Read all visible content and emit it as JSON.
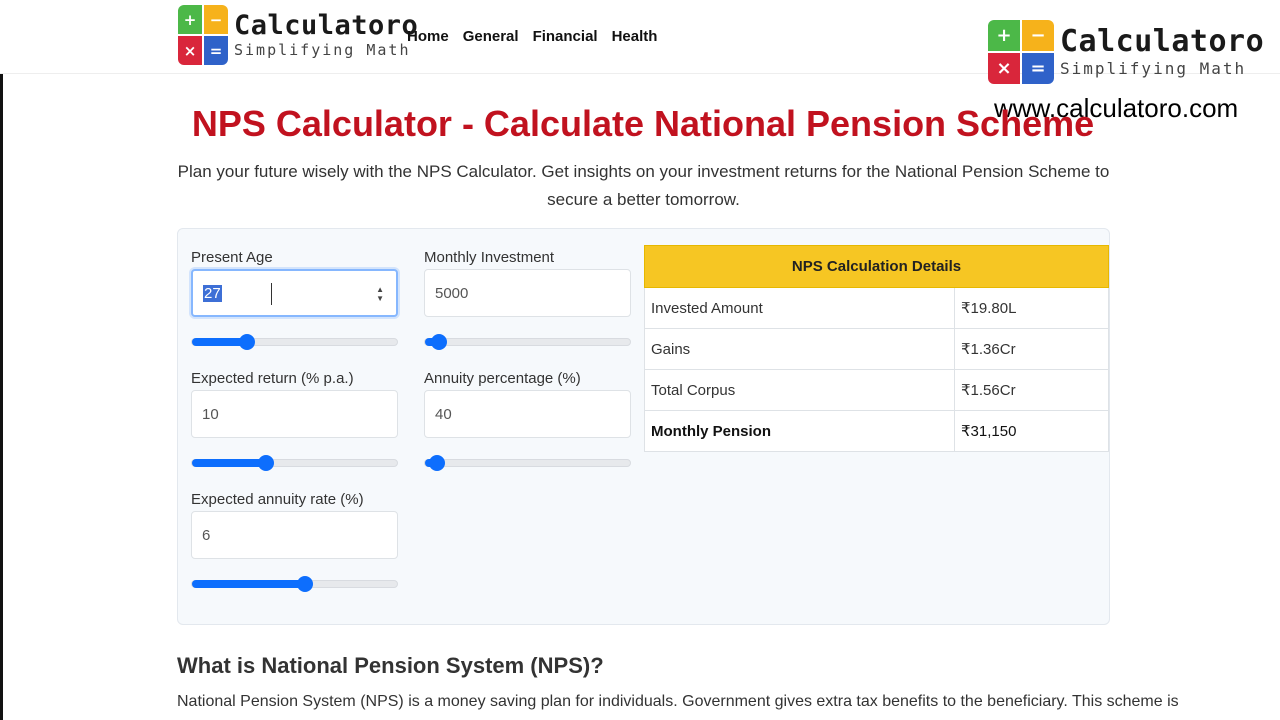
{
  "brand": {
    "logo_name": "Calculatoro",
    "logo_tagline": "Simplifying Math",
    "signs": [
      "+",
      "−",
      "×",
      "="
    ]
  },
  "nav": [
    "Home",
    "General",
    "Financial",
    "Health"
  ],
  "watermark": {
    "logo_name": "Calculatoro",
    "logo_tagline": "Simplifying Math",
    "url": "www.calculatoro.com"
  },
  "page": {
    "title": "NPS Calculator - Calculate National Pension Scheme",
    "intro": "Plan your future wisely with the NPS Calculator. Get insights on your investment returns for the National Pension Scheme to secure a better tomorrow."
  },
  "inputs": {
    "present_age": {
      "label": "Present Age",
      "value": "27",
      "slider_fraction": 0.27
    },
    "monthly_investment": {
      "label": "Monthly Investment",
      "value": "5000",
      "slider_fraction": 0.07
    },
    "expected_return": {
      "label": "Expected return (% p.a.)",
      "value": "10",
      "slider_fraction": 0.36
    },
    "annuity_percentage": {
      "label": "Annuity percentage (%)",
      "value": "40",
      "slider_fraction": 0.06
    },
    "expected_annuity_rate": {
      "label": "Expected annuity rate (%)",
      "value": "6",
      "slider_fraction": 0.55
    }
  },
  "results": {
    "heading": "NPS Calculation Details",
    "rows": [
      {
        "label": "Invested Amount",
        "value": "₹19.80L"
      },
      {
        "label": "Gains",
        "value": "₹1.36Cr"
      },
      {
        "label": "Total Corpus",
        "value": "₹1.56Cr"
      },
      {
        "label": "Monthly Pension",
        "value": "₹31,150"
      }
    ]
  },
  "section": {
    "title": "What is National Pension System (NPS)?",
    "text": "National Pension System (NPS) is a money saving plan for individuals. Government gives extra tax benefits to the beneficiary. This scheme is"
  },
  "colors": {
    "title_red": "#c1121f",
    "accent_blue": "#0d6efd",
    "table_header_yellow": "#f6c623"
  }
}
